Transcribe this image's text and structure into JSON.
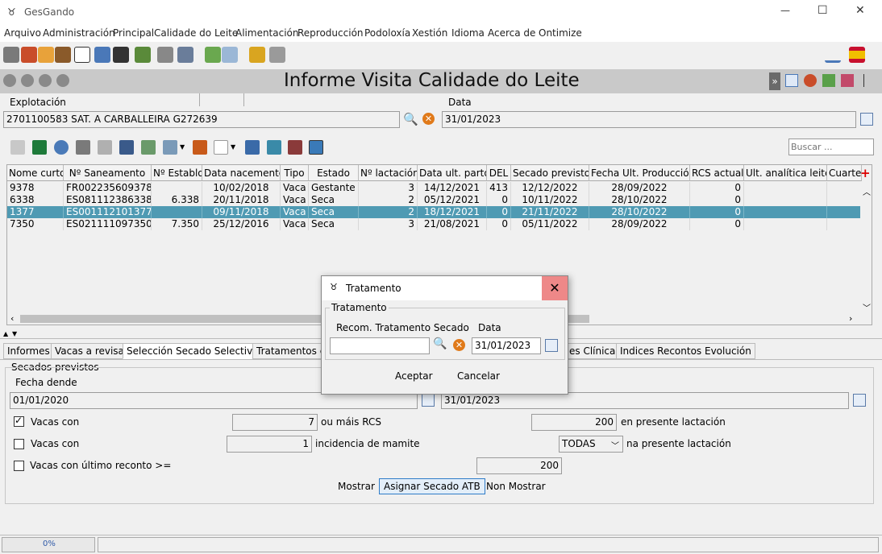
{
  "app": {
    "title": "GesGando",
    "form_title": "Informe Visita Calidade do Leite"
  },
  "window": {
    "minimize": "—",
    "maximize": "☐",
    "close": "✕"
  },
  "menu": [
    "Arquivo",
    "Administración",
    "Principal",
    "Calidade do Leite",
    "Alimentación",
    "Reproducción",
    "Podoloxía",
    "Xestión",
    "Idioma",
    "Acerca de",
    "Ontimize"
  ],
  "header": {
    "explotacion_label": "Explotación",
    "explotacion_value": "2701100583 SAT. A CARBALLEIRA G272639",
    "data_label": "Data",
    "data_value": "31/01/2023"
  },
  "search": {
    "placeholder": "Buscar ..."
  },
  "grid": {
    "columns": [
      "Nome curto",
      "Nº Saneamento",
      "Nº Establo",
      "Data nacemento",
      "Tipo",
      "Estado",
      "Nº lactación",
      "Data ult. parto",
      "DEL",
      "Secado previsto",
      "Fecha Ult. Producción",
      "RCS actual",
      "Ult. analítica leite",
      "Cuarte"
    ],
    "rows": [
      [
        "9378",
        "FR002235609378",
        "",
        "10/02/2018",
        "Vaca",
        "Gestante",
        "3",
        "14/12/2021",
        "413",
        "12/12/2022",
        "28/09/2022",
        "0",
        ""
      ],
      [
        "6338",
        "ES081112386338",
        "6.338",
        "20/11/2018",
        "Vaca",
        "Seca",
        "2",
        "05/12/2021",
        "0",
        "10/11/2022",
        "28/10/2022",
        "0",
        ""
      ],
      [
        "1377",
        "ES001112101377",
        "",
        "09/11/2018",
        "Vaca",
        "Seca",
        "2",
        "18/12/2021",
        "0",
        "21/11/2022",
        "28/10/2022",
        "0",
        ""
      ],
      [
        "7350",
        "ES021111097350",
        "7.350",
        "25/12/2016",
        "Vaca",
        "Seca",
        "3",
        "21/08/2021",
        "0",
        "05/11/2022",
        "28/09/2022",
        "0",
        ""
      ]
    ],
    "selected_row": 2
  },
  "tabs": [
    "Informes",
    "Vacas a revisar",
    "Selección Secado Selectivo",
    "Tratamentos e",
    "es Clínicas",
    "Indices Recontos Evolución"
  ],
  "secados": {
    "group_label": "Secados previstos",
    "fecha_dende_label": "Fecha dende",
    "fecha_dende_value": "01/01/2020",
    "fecha_ata_value": "31/01/2023",
    "row1": {
      "checked": true,
      "label": "Vacas con",
      "value": "7",
      "suffix": "ou máis RCS",
      "value2": "200",
      "suffix2": "en presente lactación"
    },
    "row2": {
      "checked": false,
      "label": "Vacas con",
      "value": "1",
      "suffix": "incidencia de mamite",
      "select": "TODAS",
      "suffix2": "na presente lactación"
    },
    "row3": {
      "checked": false,
      "label": "Vacas con último reconto >=",
      "value": "200"
    },
    "buttons": {
      "mostrar": "Mostrar",
      "asignar": "Asignar Secado ATB",
      "non_mostrar": "Non Mostrar"
    }
  },
  "dialog": {
    "title": "Tratamento",
    "group_label": "Tratamento",
    "recom_label": "Recom. Tratamento Secado",
    "data_label": "Data",
    "recom_value": "",
    "data_value": "31/01/2023",
    "accept": "Aceptar",
    "cancel": "Cancelar"
  },
  "status": {
    "progress_label": "0%",
    "progress": 0
  }
}
